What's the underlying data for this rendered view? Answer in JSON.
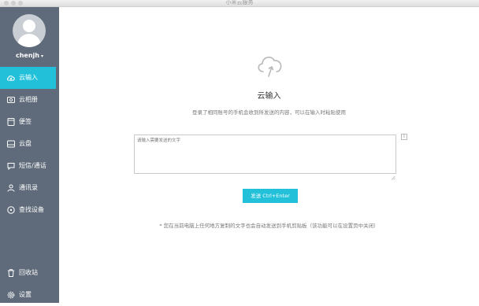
{
  "window": {
    "title": "小米云服务"
  },
  "user": {
    "name": "chenjh",
    "caret": "▾"
  },
  "sidebar": {
    "items": [
      {
        "label": "云输入"
      },
      {
        "label": "云相册"
      },
      {
        "label": "便签"
      },
      {
        "label": "云盘"
      },
      {
        "label": "短信/通话"
      },
      {
        "label": "通讯录"
      },
      {
        "label": "查找设备"
      },
      {
        "label": "回收站"
      },
      {
        "label": "设置"
      }
    ]
  },
  "main": {
    "heading": "云输入",
    "description": "登录了相同账号的手机会收到所发送的内容，可以在输入时粘贴使用",
    "input": {
      "placeholder": "请输入需要发送的文字",
      "value": ""
    },
    "info_button": "i",
    "send_label": "发送 Ctrl+Enter",
    "footnote": "* 您在当前电脑上任何地方复制的文字也会自动发送到手机剪贴板（该功能可以在设置页中关闭）"
  },
  "colors": {
    "accent": "#22c1d9",
    "sidebar": "#5f6b7a"
  }
}
